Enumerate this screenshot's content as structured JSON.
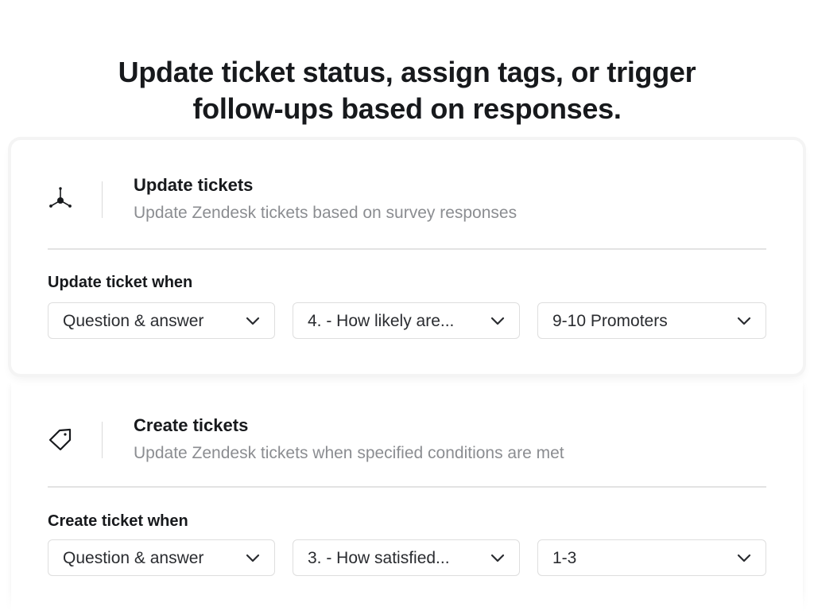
{
  "headline": {
    "line1": "Update ticket status, assign tags, or trigger",
    "line2": "follow-ups based on responses."
  },
  "cards": [
    {
      "icon": "nodes-connection-icon",
      "title": "Update tickets",
      "subtitle": "Update Zendesk tickets based on survey responses",
      "rule_label": "Update ticket when",
      "selects": [
        {
          "value": "Question & answer"
        },
        {
          "value": "4. - How likely are..."
        },
        {
          "value": "9-10 Promoters"
        }
      ]
    },
    {
      "icon": "tag-icon",
      "title": "Create tickets",
      "subtitle": "Update Zendesk tickets when specified conditions are met",
      "rule_label": "Create ticket when",
      "selects": [
        {
          "value": "Question & answer"
        },
        {
          "value": "3. - How satisfied..."
        },
        {
          "value": "1-3"
        }
      ]
    }
  ],
  "colors": {
    "text_primary": "#17191c",
    "text_secondary": "#8b8d91",
    "border": "#dedede",
    "divider": "#e3e3e3"
  }
}
